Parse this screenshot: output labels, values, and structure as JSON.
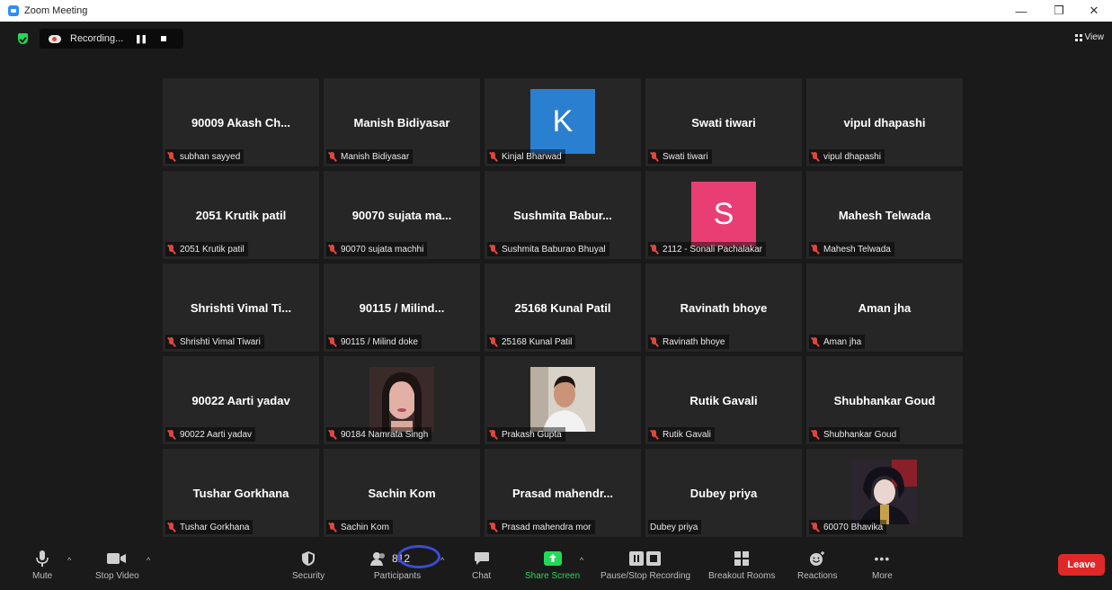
{
  "window": {
    "title": "Zoom Meeting",
    "minimize": "—",
    "maximize": "❐",
    "close": "✕"
  },
  "recording": {
    "status": "Recording...",
    "pause_icon": "pause-icon",
    "stop_icon": "stop-icon"
  },
  "view_label": "View",
  "tiles": [
    {
      "display": "90009 Akash Ch...",
      "name": "subhan sayyed"
    },
    {
      "display": "Manish Bidiyasar",
      "name": "Manish Bidiyasar"
    },
    {
      "avatar_letter": "K",
      "avatar_color": "#2b7fd0",
      "name": "Kinjal Bharwad"
    },
    {
      "display": "Swati tiwari",
      "name": "Swati tiwari"
    },
    {
      "display": "vipul dhapashi",
      "name": "vipul dhapashi"
    },
    {
      "display": "2051 Krutik patil",
      "name": "2051 Krutik patil"
    },
    {
      "display": "90070 sujata ma...",
      "name": "90070 sujata machhi"
    },
    {
      "display": "Sushmita  Babur...",
      "name": "Sushmita Baburao Bhuyal"
    },
    {
      "avatar_letter": "S",
      "avatar_color": "#e83e73",
      "name": "2112 - Sonali Pachalakar"
    },
    {
      "display": "Mahesh Telwada",
      "name": "Mahesh Telwada"
    },
    {
      "display": "Shrishti Vimal Ti...",
      "name": "Shrishti Vimal Tiwari"
    },
    {
      "display": "90115 / Milind...",
      "name": "90115 / Milind doke"
    },
    {
      "display": "25168 Kunal Patil",
      "name": "25168 Kunal Patil"
    },
    {
      "display": "Ravinath bhoye",
      "name": "Ravinath bhoye"
    },
    {
      "display": "Aman jha",
      "name": "Aman jha"
    },
    {
      "display": "90022 Aarti yadav",
      "name": "90022 Aarti yadav"
    },
    {
      "photo": "woman-portrait",
      "name": "90184 Namrata Singh"
    },
    {
      "photo": "man-portrait",
      "name": "Prakash Gupta"
    },
    {
      "display": "Rutik Gavali",
      "name": "Rutik Gavali"
    },
    {
      "display": "Shubhankar Goud",
      "name": "Shubhankar Goud"
    },
    {
      "display": "Tushar Gorkhana",
      "name": "Tushar Gorkhana"
    },
    {
      "display": "Sachin Kom",
      "name": "Sachin Kom"
    },
    {
      "display": "Prasad  mahendr...",
      "name": "Prasad mahendra mor"
    },
    {
      "display": "Dubey priya",
      "name": "Dubey priya",
      "no_mic_icon": true
    },
    {
      "photo": "anime-avatar",
      "name": "60070 Bhavika"
    }
  ],
  "toolbar": {
    "mute": "Mute",
    "stop_video": "Stop Video",
    "security": "Security",
    "participants": "Participants",
    "participant_count": "812",
    "chat": "Chat",
    "share_screen": "Share Screen",
    "pause_stop_recording": "Pause/Stop Recording",
    "breakout_rooms": "Breakout Rooms",
    "reactions": "Reactions",
    "more": "More",
    "leave": "Leave"
  },
  "colors": {
    "share_green": "#23d959",
    "leave_red": "#e02828",
    "muted_red": "#e0463d",
    "highlight_blue": "#3b4cd8"
  }
}
